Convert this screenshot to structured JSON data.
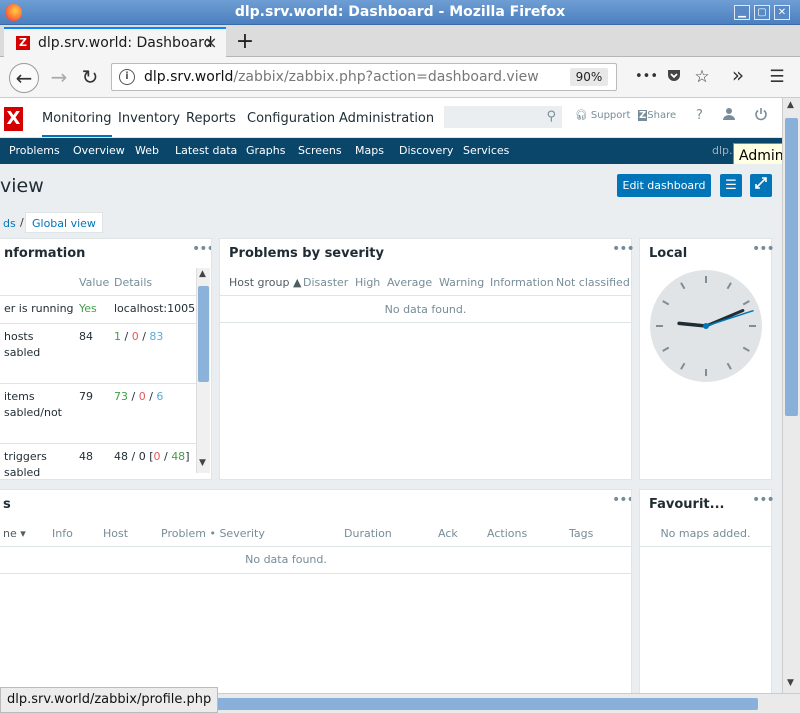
{
  "window": {
    "title": "dlp.srv.world: Dashboard - Mozilla Firefox"
  },
  "tab": {
    "title": "dlp.srv.world: Dashboard",
    "close": "×",
    "new": "+"
  },
  "nav": {
    "url_host": "dlp.srv.world",
    "url_path": "/zabbix/zabbix.php?action=dashboard.view",
    "zoom": "90%",
    "more": "•••",
    "overflow": "»",
    "menu": "☰"
  },
  "zabbix": {
    "logo": "X",
    "menu": [
      "Monitoring",
      "Inventory",
      "Reports",
      "Configuration",
      "Administration"
    ],
    "support": "Support",
    "share": "Share",
    "help": "?",
    "submenu": [
      "Problems",
      "Overview",
      "Web",
      "Latest data",
      "Graphs",
      "Screens",
      "Maps",
      "Discovery",
      "Services"
    ],
    "submenu_right": "dlp.s",
    "tooltip": "Admin (Z"
  },
  "page": {
    "title": "view",
    "edit_button": "Edit dashboard",
    "breadcrumb_prev": "ds",
    "breadcrumb_sep": "/",
    "breadcrumb_current": "Global view"
  },
  "sysinfo": {
    "title": "nformation",
    "headers": [
      "Value",
      "Details"
    ],
    "rows": [
      {
        "param": "er is running",
        "value": "Yes",
        "details": "localhost:10051"
      },
      {
        "param": "hosts",
        "param2": "sabled",
        "value": "84",
        "d1": "1",
        "d2": "0",
        "d3": "83"
      },
      {
        "param": "items",
        "param2": "sabled/not",
        "value": "79",
        "d1": "73",
        "d2": "0",
        "d3": "6"
      },
      {
        "param": "triggers",
        "param2": "sabled",
        "value": "48",
        "dpre": "48 / 0 [",
        "d1": "0",
        "dsep": " / ",
        "d2": "48",
        "dpost": "]"
      }
    ]
  },
  "severity": {
    "title": "Problems by severity",
    "headers": [
      "Host group ▲",
      "Disaster",
      "High",
      "Average",
      "Warning",
      "Information",
      "Not classified"
    ],
    "empty": "No data found."
  },
  "clock": {
    "title": "Local",
    "hour": 9,
    "minute": 11,
    "second": 12
  },
  "problems": {
    "title": "s",
    "headers": [
      "ne ▾",
      "Info",
      "Host",
      "Problem • Severity",
      "Duration",
      "Ack",
      "Actions",
      "Tags"
    ],
    "empty": "No data found."
  },
  "favourites": {
    "title": "Favourit...",
    "empty": "No maps added."
  },
  "widget_menu": "•••",
  "status_url": "dlp.srv.world/zabbix/profile.php",
  "colors": {
    "brand": "#d40000",
    "accent": "#0275b8",
    "subnav": "#0a466a",
    "ok": "#429e47",
    "problem": "#e45959",
    "disabled": "#59a9d9"
  }
}
